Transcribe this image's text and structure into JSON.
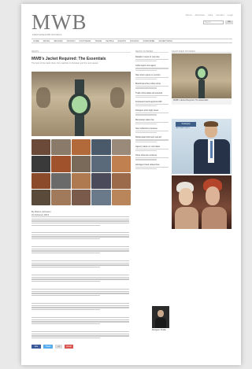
{
  "site": {
    "logo": "MWB",
    "tagline": "MENSWEARBUSINESS",
    "toplinks": [
      "About",
      "Advertise",
      "Jobs",
      "Contact",
      "Login"
    ],
    "search_placeholder": "Search",
    "search_button": "Go"
  },
  "nav": {
    "items": [
      "HOME",
      "RETAIL",
      "BRANDS",
      "OPINION",
      "FOOTWEAR",
      "TRADE",
      "PEOPLE",
      "EVENTS",
      "FASHION",
      "SUBSCRIBE",
      "ADVERTISING"
    ]
  },
  "columns": {
    "main_head": "NEWS",
    "mid_head": "NEWS IN BRIEF",
    "right_head": "FEATURED STORIES"
  },
  "article": {
    "title": "MWB's Jacket Required: The Essentials",
    "subtitle": "The best of the trade show, from watches to footwear and the new season",
    "byline": "By Robert Johnston",
    "date": "21 February 2013"
  },
  "mid_items": [
    "Retailer moves to new site",
    "Label signs new agent",
    "New store opens in London",
    "Brand launches online shop",
    "Trade show dates announced",
    "Footwear brand appoints MD",
    "Designer joins high street",
    "Menswear sales rise",
    "New collection previews",
    "Retail award winners named",
    "Agency takes on new label",
    "Store closures continue",
    "Heritage brand relaunches"
  ],
  "right": {
    "ad1_caption": "MWB's Jacket Required: The Essentials",
    "ad2_tag": "Suitsupply",
    "ad2_sub": "TAILORED SUITS"
  },
  "share": {
    "facebook": "Like",
    "twitter": "Tweet",
    "google": "+1",
    "email": "Email"
  },
  "bottom": {
    "label": "Designer Profile"
  },
  "colors": {
    "facebook": "#3b5998",
    "twitter": "#55acee",
    "google": "#dddddd",
    "email": "#d9534f",
    "accent": "#3d5f8a"
  }
}
